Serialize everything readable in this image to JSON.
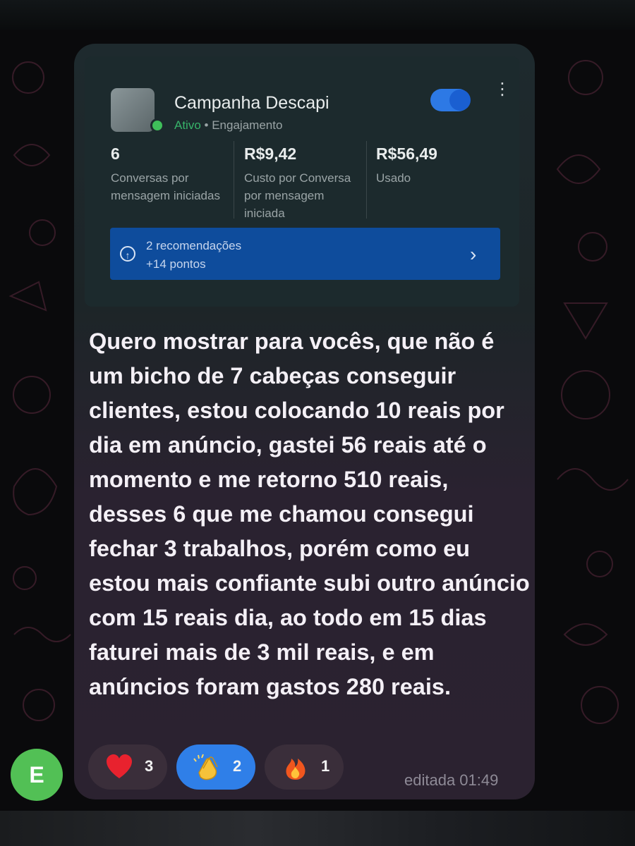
{
  "campaign": {
    "name": "Campanha Descapi",
    "status": "Ativo",
    "separator": "•",
    "objective": "Engajamento",
    "toggle_on": true,
    "metrics": [
      {
        "value": "6",
        "label": "Conversas por mensagem iniciadas"
      },
      {
        "value": "R$9,42",
        "label": "Custo por Conversa por mensagem iniciada"
      },
      {
        "value": "R$56,49",
        "label": "Usado"
      }
    ],
    "recommendations": {
      "line1": "2 recomendações",
      "line2": "+14 pontos"
    }
  },
  "message": {
    "text": "Quero mostrar para vocês, que não é um bicho de 7 cabeças conseguir clientes,  estou colocando 10 reais por dia em anúncio, gastei 56 reais até o momento e me retorno 510 reais,  desses 6 que me chamou consegui fechar 3 trabalhos, porém como eu estou mais confiante subi outro anúncio com 15 reais dia, ao todo em 15 dias faturei mais de 3 mil reais, e  em anúncios foram gastos 280 reais.",
    "edited_label": "editada 01:49"
  },
  "reactions": [
    {
      "icon": "heart-icon",
      "count": "3",
      "selected": false
    },
    {
      "icon": "clapping-hands-icon",
      "count": "2",
      "selected": true
    },
    {
      "icon": "fire-icon",
      "count": "1",
      "selected": false
    }
  ],
  "sender": {
    "initial": "E",
    "color": "#52c055"
  },
  "colors": {
    "accent": "#2f7fe8",
    "active": "#37b36a",
    "reco_bg": "#0e4c9c"
  }
}
